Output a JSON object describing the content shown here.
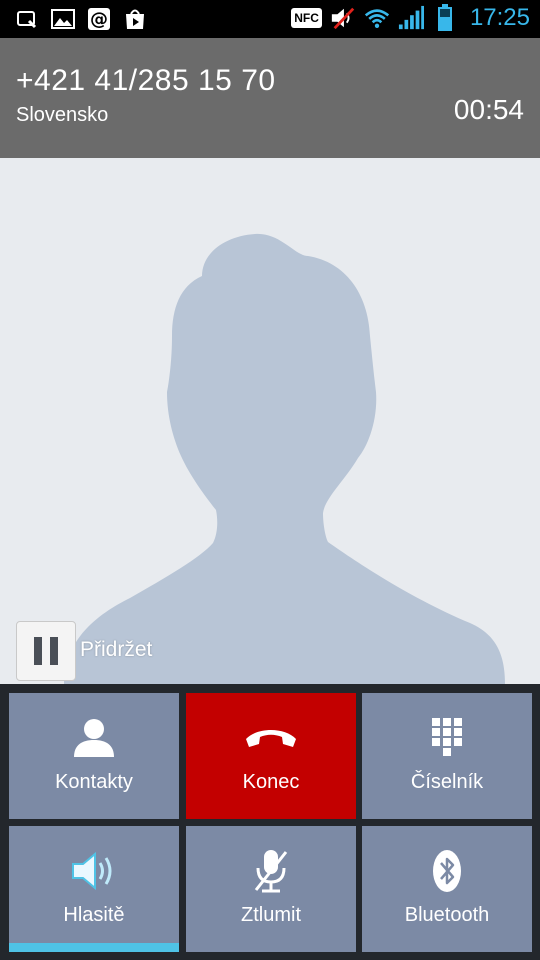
{
  "status_bar": {
    "nfc_label": "NFC",
    "time": "17:25",
    "left_icons": [
      "search-app-icon",
      "gallery-icon",
      "email-icon",
      "play-store-icon"
    ],
    "right_icons": [
      "nfc-icon",
      "sound-muted-icon",
      "wifi-icon",
      "signal-icon",
      "battery-icon"
    ]
  },
  "call": {
    "number": "+421 41/285 15 70",
    "location": "Slovensko",
    "duration": "00:54"
  },
  "hold": {
    "label": "Přidržet"
  },
  "actions": {
    "contacts": "Kontakty",
    "end": "Konec",
    "dialpad": "Číselník",
    "speaker": "Hlasitě",
    "mute": "Ztlumit",
    "bluetooth": "Bluetooth"
  },
  "colors": {
    "header_bg": "#6b6b6b",
    "tile_bg": "#7c8aa5",
    "end_call": "#c30000",
    "active_indicator": "#4fc3e6",
    "clock": "#38b7ea"
  }
}
